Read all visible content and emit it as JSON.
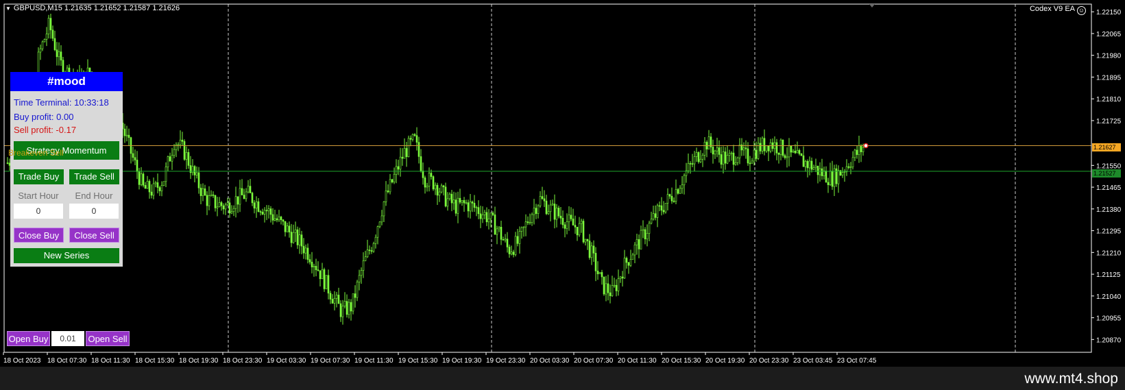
{
  "chart": {
    "symbol_info": "GBPUSD,M15  1.21635 1.21652 1.21587 1.21626",
    "ea_name": "Codex V9 EA",
    "ea_icon": "smiley-icon",
    "bid_tag": "1.21627",
    "line_tag": "1.21527",
    "breakeven_label": "Breakeven Sell",
    "colors": {
      "candle": "#7cfc3c",
      "grid": "#ffffff",
      "bid_line": "#d19a3a",
      "level_line": "#1fa82c"
    }
  },
  "chart_data": {
    "type": "candlestick",
    "symbol": "GBPUSD",
    "timeframe": "M15",
    "ylim": [
      1.2082,
      1.2218
    ],
    "y_ticks": [
      "1.22150",
      "1.22065",
      "1.21980",
      "1.21895",
      "1.21810",
      "1.21725",
      "1.21550",
      "1.21465",
      "1.21380",
      "1.21295",
      "1.21210",
      "1.21125",
      "1.21040",
      "1.20955",
      "1.20870"
    ],
    "x_ticks": [
      "18 Oct 2023",
      "18 Oct 07:30",
      "18 Oct 11:30",
      "18 Oct 15:30",
      "18 Oct 19:30",
      "18 Oct 23:30",
      "19 Oct 03:30",
      "19 Oct 07:30",
      "19 Oct 11:30",
      "19 Oct 15:30",
      "19 Oct 19:30",
      "19 Oct 23:30",
      "20 Oct 03:30",
      "20 Oct 07:30",
      "20 Oct 11:30",
      "20 Oct 15:30",
      "20 Oct 19:30",
      "20 Oct 23:30",
      "23 Oct 03:45",
      "23 Oct 07:45"
    ],
    "close_anchors": [
      1.2156,
      1.216,
      1.2165,
      1.2198,
      1.221,
      1.2195,
      1.219,
      1.2188,
      1.2192,
      1.2165,
      1.218,
      1.217,
      1.2158,
      1.2146,
      1.2145,
      1.215,
      1.2165,
      1.216,
      1.215,
      1.2142,
      1.214,
      1.2139,
      1.2142,
      1.2144,
      1.214,
      1.2137,
      1.2133,
      1.2129,
      1.2125,
      1.212,
      1.2113,
      1.2105,
      1.2098,
      1.21,
      1.2115,
      1.2125,
      1.214,
      1.215,
      1.216,
      1.2165,
      1.215,
      1.2148,
      1.2142,
      1.2139,
      1.214,
      1.2138,
      1.2135,
      1.213,
      1.2122,
      1.2125,
      1.2135,
      1.2142,
      1.2138,
      1.2135,
      1.2132,
      1.213,
      1.212,
      1.2108,
      1.2105,
      1.2115,
      1.2122,
      1.2128,
      1.2135,
      1.214,
      1.2145,
      1.2152,
      1.2158,
      1.2164,
      1.216,
      1.2157,
      1.216,
      1.2158,
      1.2162,
      1.2164,
      1.2162,
      1.2159,
      1.2157,
      1.2155,
      1.2152,
      1.215,
      1.2153,
      1.2158,
      1.2162
    ],
    "bid_price": 1.21627,
    "level_price": 1.21527
  },
  "panel": {
    "title": "#mood",
    "time_terminal": "Time Terminal: 10:33:18",
    "buy_profit": "Buy profit: 0.00",
    "sell_profit": "Sell profit: -0.17",
    "strategy_button": "Strategy Momentum",
    "trade_buy": "Trade Buy",
    "trade_sell": "Trade Sell",
    "start_hour_label": "Start Hour",
    "end_hour_label": "End Hour",
    "start_hour_value": "0",
    "end_hour_value": "0",
    "close_buy": "Close Buy",
    "close_sell": "Close Sell",
    "new_series": "New Series"
  },
  "order_bar": {
    "open_buy": "Open Buy",
    "lot_value": "0.01",
    "open_sell": "Open Sell"
  },
  "footer": {
    "watermark": "www.mt4.shop"
  }
}
